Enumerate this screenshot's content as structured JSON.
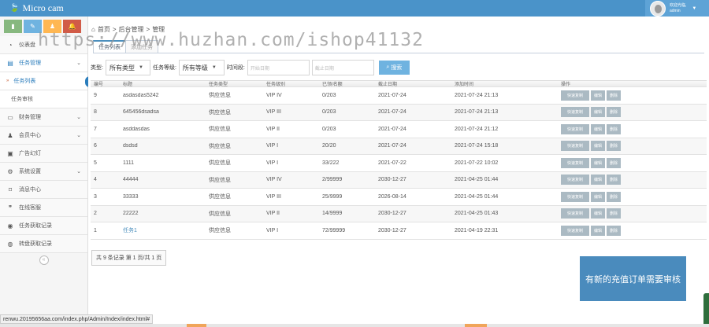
{
  "brand": {
    "name": "Micro cam"
  },
  "user": {
    "greeting": "欢迎光临,",
    "name": "admin"
  },
  "sidebar": {
    "shortcuts": [
      {
        "icon": "signal-icon",
        "color": "#87b87f"
      },
      {
        "icon": "pencil-icon",
        "color": "#6fb3e0"
      },
      {
        "icon": "users-icon",
        "color": "#ffb752"
      },
      {
        "icon": "bell-icon",
        "color": "#d15b47"
      }
    ],
    "items": [
      {
        "label": "仪表盘",
        "icon": "tachometer-icon"
      },
      {
        "label": "任务管理",
        "icon": "book-icon",
        "expanded": true
      },
      {
        "label": "任务列表",
        "current": true
      },
      {
        "label": "任务审核"
      },
      {
        "label": "财务管理",
        "icon": "card-icon"
      },
      {
        "label": "会员中心",
        "icon": "users-icon"
      },
      {
        "label": "广告幻灯",
        "icon": "picture-icon"
      },
      {
        "label": "系统设置",
        "icon": "cog-icon"
      },
      {
        "label": "消息中心",
        "icon": "bookmark-icon"
      },
      {
        "label": "在线客服",
        "icon": "comments-icon"
      },
      {
        "label": "任务获取记录",
        "icon": "tasks-icon"
      },
      {
        "label": "转盘获取记录",
        "icon": "globe-icon"
      }
    ]
  },
  "breadcrumb": {
    "home": "首页",
    "section": "后台管理",
    "page": "管理"
  },
  "tabs": [
    {
      "label": "任务列表"
    },
    {
      "label": "添加任务"
    }
  ],
  "filters": {
    "type_label": "类型:",
    "type_value": "所有类型",
    "level_label": "任务等级:",
    "level_value": "所有等级",
    "time_label": "时间段:",
    "start_placeholder": "开始日期",
    "end_placeholder": "截止日期",
    "search_label": "搜索"
  },
  "table": {
    "headers": [
      "编号",
      "标题",
      "任务类型",
      "任务级别",
      "已领/名额",
      "截止日期",
      "添加时间",
      "操作"
    ],
    "rows": [
      {
        "id": "9",
        "title": "asdasdas5242",
        "type": "供应信息",
        "level": "VIP IV",
        "quota": "0/203",
        "deadline": "2021-07-24",
        "added": "2021-07-24 21:13"
      },
      {
        "id": "8",
        "title": "645456dsadsa",
        "type": "供应信息",
        "level": "VIP III",
        "quota": "0/203",
        "deadline": "2021-07-24",
        "added": "2021-07-24 21:13"
      },
      {
        "id": "7",
        "title": "asddasdas",
        "type": "供应信息",
        "level": "VIP II",
        "quota": "0/203",
        "deadline": "2021-07-24",
        "added": "2021-07-24 21:12"
      },
      {
        "id": "6",
        "title": "dsdsd",
        "type": "供应信息",
        "level": "VIP I",
        "quota": "20/20",
        "deadline": "2021-07-24",
        "added": "2021-07-24 15:18"
      },
      {
        "id": "5",
        "title": "1111",
        "type": "供应信息",
        "level": "VIP I",
        "quota": "33/222",
        "deadline": "2021-07-22",
        "added": "2021-07-22 10:02"
      },
      {
        "id": "4",
        "title": "44444",
        "type": "供应信息",
        "level": "VIP IV",
        "quota": "2/99999",
        "deadline": "2030-12-27",
        "added": "2021-04-25 01:44"
      },
      {
        "id": "3",
        "title": "33333",
        "type": "供应信息",
        "level": "VIP III",
        "quota": "25/9999",
        "deadline": "2026-08-14",
        "added": "2021-04-25 01:44"
      },
      {
        "id": "2",
        "title": "22222",
        "type": "供应信息",
        "level": "VIP II",
        "quota": "14/9999",
        "deadline": "2030-12-27",
        "added": "2021-04-25 01:43"
      },
      {
        "id": "1",
        "title": "任务1",
        "type": "供应信息",
        "level": "VIP I",
        "quota": "72/99999",
        "deadline": "2030-12-27",
        "added": "2021-04-19 22:31"
      }
    ],
    "actions": [
      "快速复制",
      "编辑",
      "删除"
    ]
  },
  "pager": {
    "text": "共 9 条记录 第 1 页/共 1 页"
  },
  "notice": {
    "text": "有新的充值订单需要审核"
  },
  "statusbar": {
    "url": "renwu.20195656aa.com/index.php/Admin/Index/index.html#"
  },
  "watermark": {
    "text": "https://www.huzhan.com/ishop41132"
  }
}
